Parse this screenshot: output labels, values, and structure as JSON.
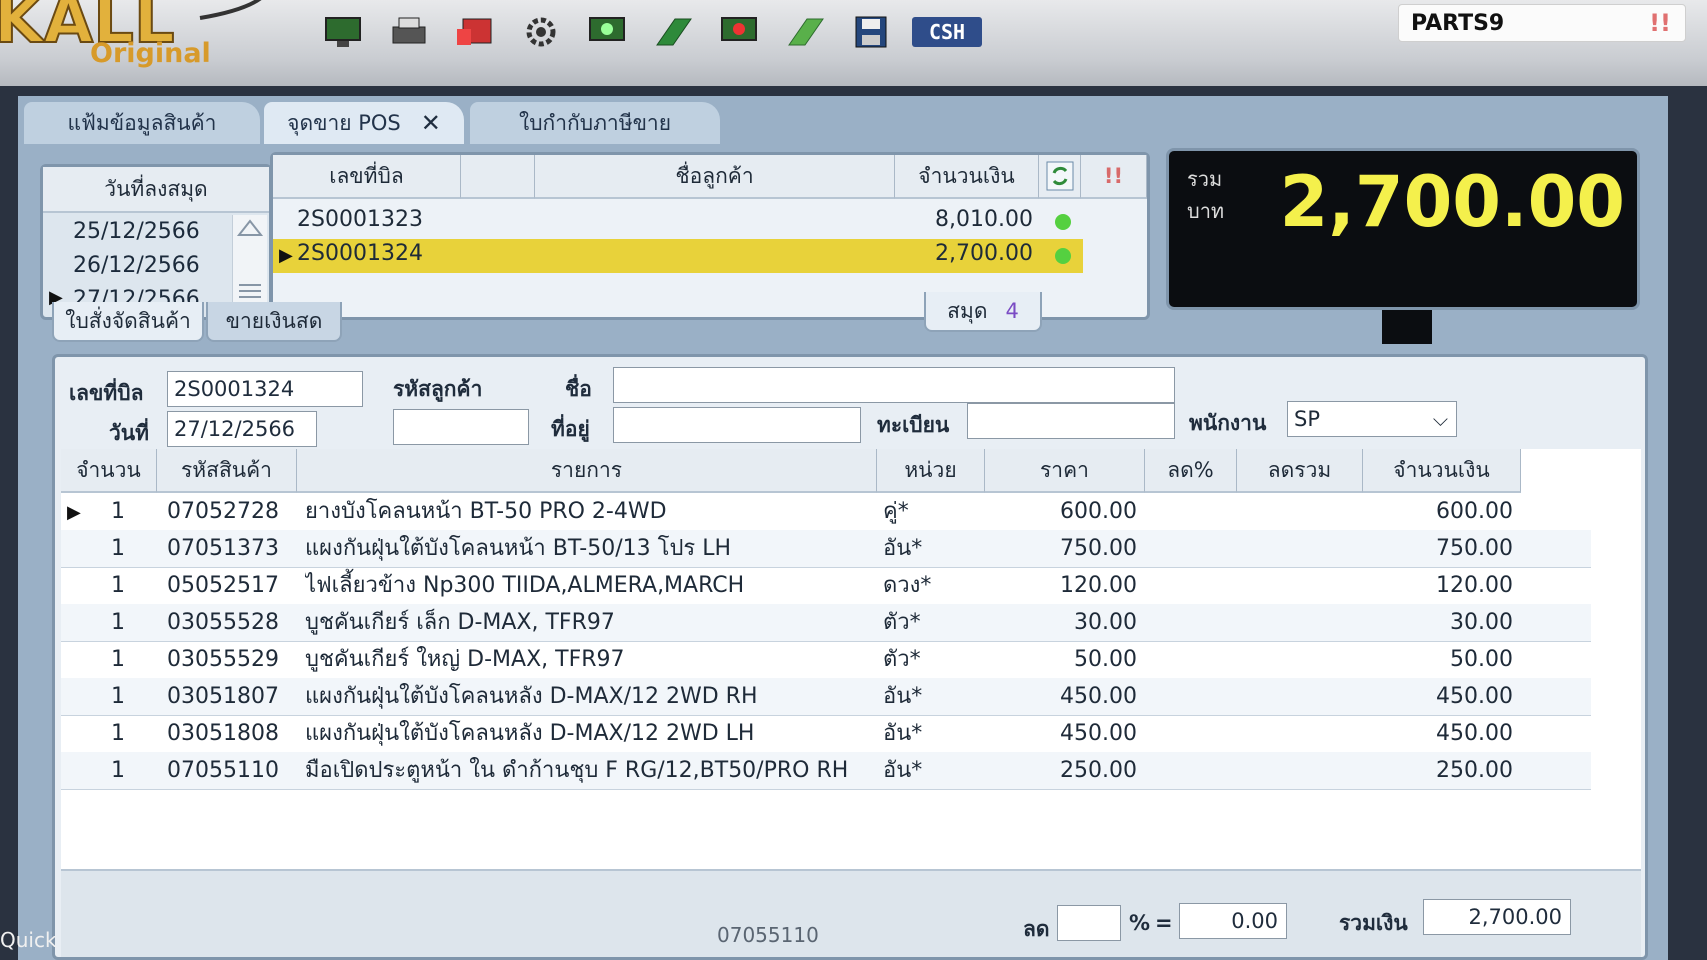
{
  "app": {
    "logo_sub": "Original"
  },
  "toolbar": {
    "icons": [
      "monitor-icon",
      "printer-icon",
      "card-reader-icon",
      "gear-icon",
      "monitor-add-icon",
      "green-tag-icon",
      "monitor-remove-icon",
      "green-tag-edit-icon",
      "save-icon"
    ],
    "csh_label": "CSH"
  },
  "user": {
    "name": "PARTS9",
    "alert": "!!"
  },
  "tabs": [
    {
      "label": "แฟ้มข้อมูลสินค้า"
    },
    {
      "label": "จุดขาย POS",
      "close": "✕"
    },
    {
      "label": "ใบกำกับภาษีขาย"
    }
  ],
  "date_list": {
    "header": "วันที่ลงสมุด",
    "rows": [
      "25/12/2566",
      "26/12/2566",
      "27/12/2566"
    ]
  },
  "bills": {
    "headers": {
      "bill_no": "เลขที่บิล",
      "customer": "ชื่อลูกค้า",
      "amount": "จำนวนเงิน",
      "alert": "!!"
    },
    "rows": [
      {
        "bill_no": "2S0001323",
        "customer": "",
        "amount": "8,010.00"
      },
      {
        "bill_no": "2S0001324",
        "customer": "",
        "amount": "2,700.00"
      }
    ],
    "status_color": "#55d040"
  },
  "total": {
    "label1": "รวม",
    "label2": "บาท",
    "amount": "2,700.00"
  },
  "subtabs": {
    "order": "ใบสั่งจัดสินค้า",
    "cash": "ขายเงินสด",
    "book": "สมุด",
    "book_no": "4"
  },
  "form": {
    "bill_no_label": "เลขที่บิล",
    "bill_no": "2S0001324",
    "date_label": "วันที่",
    "date": "27/12/2566",
    "customer_code_label": "รหัสลูกค้า",
    "customer_code": "",
    "name_label": "ชื่อ",
    "name": "",
    "address_label": "ที่อยู่",
    "address": "",
    "reg_label": "ทะเบียน",
    "reg": "",
    "staff_label": "พนักงาน",
    "staff": "SP"
  },
  "items": {
    "headers": {
      "qty": "จำนวน",
      "code": "รหัสสินค้า",
      "desc": "รายการ",
      "unit": "หน่วย",
      "price": "ราคา",
      "disc_pct": "ลด%",
      "disc_total": "ลดรวม",
      "amount": "จำนวนเงิน"
    },
    "rows": [
      {
        "qty": "1",
        "code": "07052728",
        "desc": "ยางบังโคลนหน้า  BT-50 PRO 2-4WD",
        "unit": "คู่*",
        "price": "600.00",
        "disc_pct": "",
        "disc_total": "",
        "amount": "600.00"
      },
      {
        "qty": "1",
        "code": "07051373",
        "desc": "แผงกันฝุ่นใต้บังโคลนหน้า  BT-50/13 โปร  LH",
        "unit": "อัน*",
        "price": "750.00",
        "disc_pct": "",
        "disc_total": "",
        "amount": "750.00"
      },
      {
        "qty": "1",
        "code": "05052517",
        "desc": "ไฟเลี้ยวข้าง Np300  TIIDA,ALMERA,MARCH",
        "unit": "ดวง*",
        "price": "120.00",
        "disc_pct": "",
        "disc_total": "",
        "amount": "120.00"
      },
      {
        "qty": "1",
        "code": "03055528",
        "desc": "บูชคันเกียร์ เล็ก  D-MAX, TFR97",
        "unit": "ตัว*",
        "price": "30.00",
        "disc_pct": "",
        "disc_total": "",
        "amount": "30.00"
      },
      {
        "qty": "1",
        "code": "03055529",
        "desc": "บูชคันเกียร์ ใหญ่  D-MAX, TFR97",
        "unit": "ตัว*",
        "price": "50.00",
        "disc_pct": "",
        "disc_total": "",
        "amount": "50.00"
      },
      {
        "qty": "1",
        "code": "03051807",
        "desc": "แผงกันฝุ่นใต้บังโคลนหลัง  D-MAX/12 2WD  RH",
        "unit": "อัน*",
        "price": "450.00",
        "disc_pct": "",
        "disc_total": "",
        "amount": "450.00"
      },
      {
        "qty": "1",
        "code": "03051808",
        "desc": "แผงกันฝุ่นใต้บังโคลนหลัง  D-MAX/12 2WD  LH",
        "unit": "อัน*",
        "price": "450.00",
        "disc_pct": "",
        "disc_total": "",
        "amount": "450.00"
      },
      {
        "qty": "1",
        "code": "07055110",
        "desc": "มือเปิดประตูหน้า ใน ดำก้านชุบ  F RG/12,BT50/PRO  RH",
        "unit": "อัน*",
        "price": "250.00",
        "disc_pct": "",
        "disc_total": "",
        "amount": "250.00"
      }
    ]
  },
  "footer": {
    "selected_code": "07055110",
    "discount_label": "ลด",
    "discount_pct": "",
    "pct_sign": "%",
    "equals": "=",
    "discount_amount": "0.00",
    "total_label": "รวมเงิน",
    "total_value": "2,700.00"
  },
  "side": {
    "quick": "Quick"
  }
}
